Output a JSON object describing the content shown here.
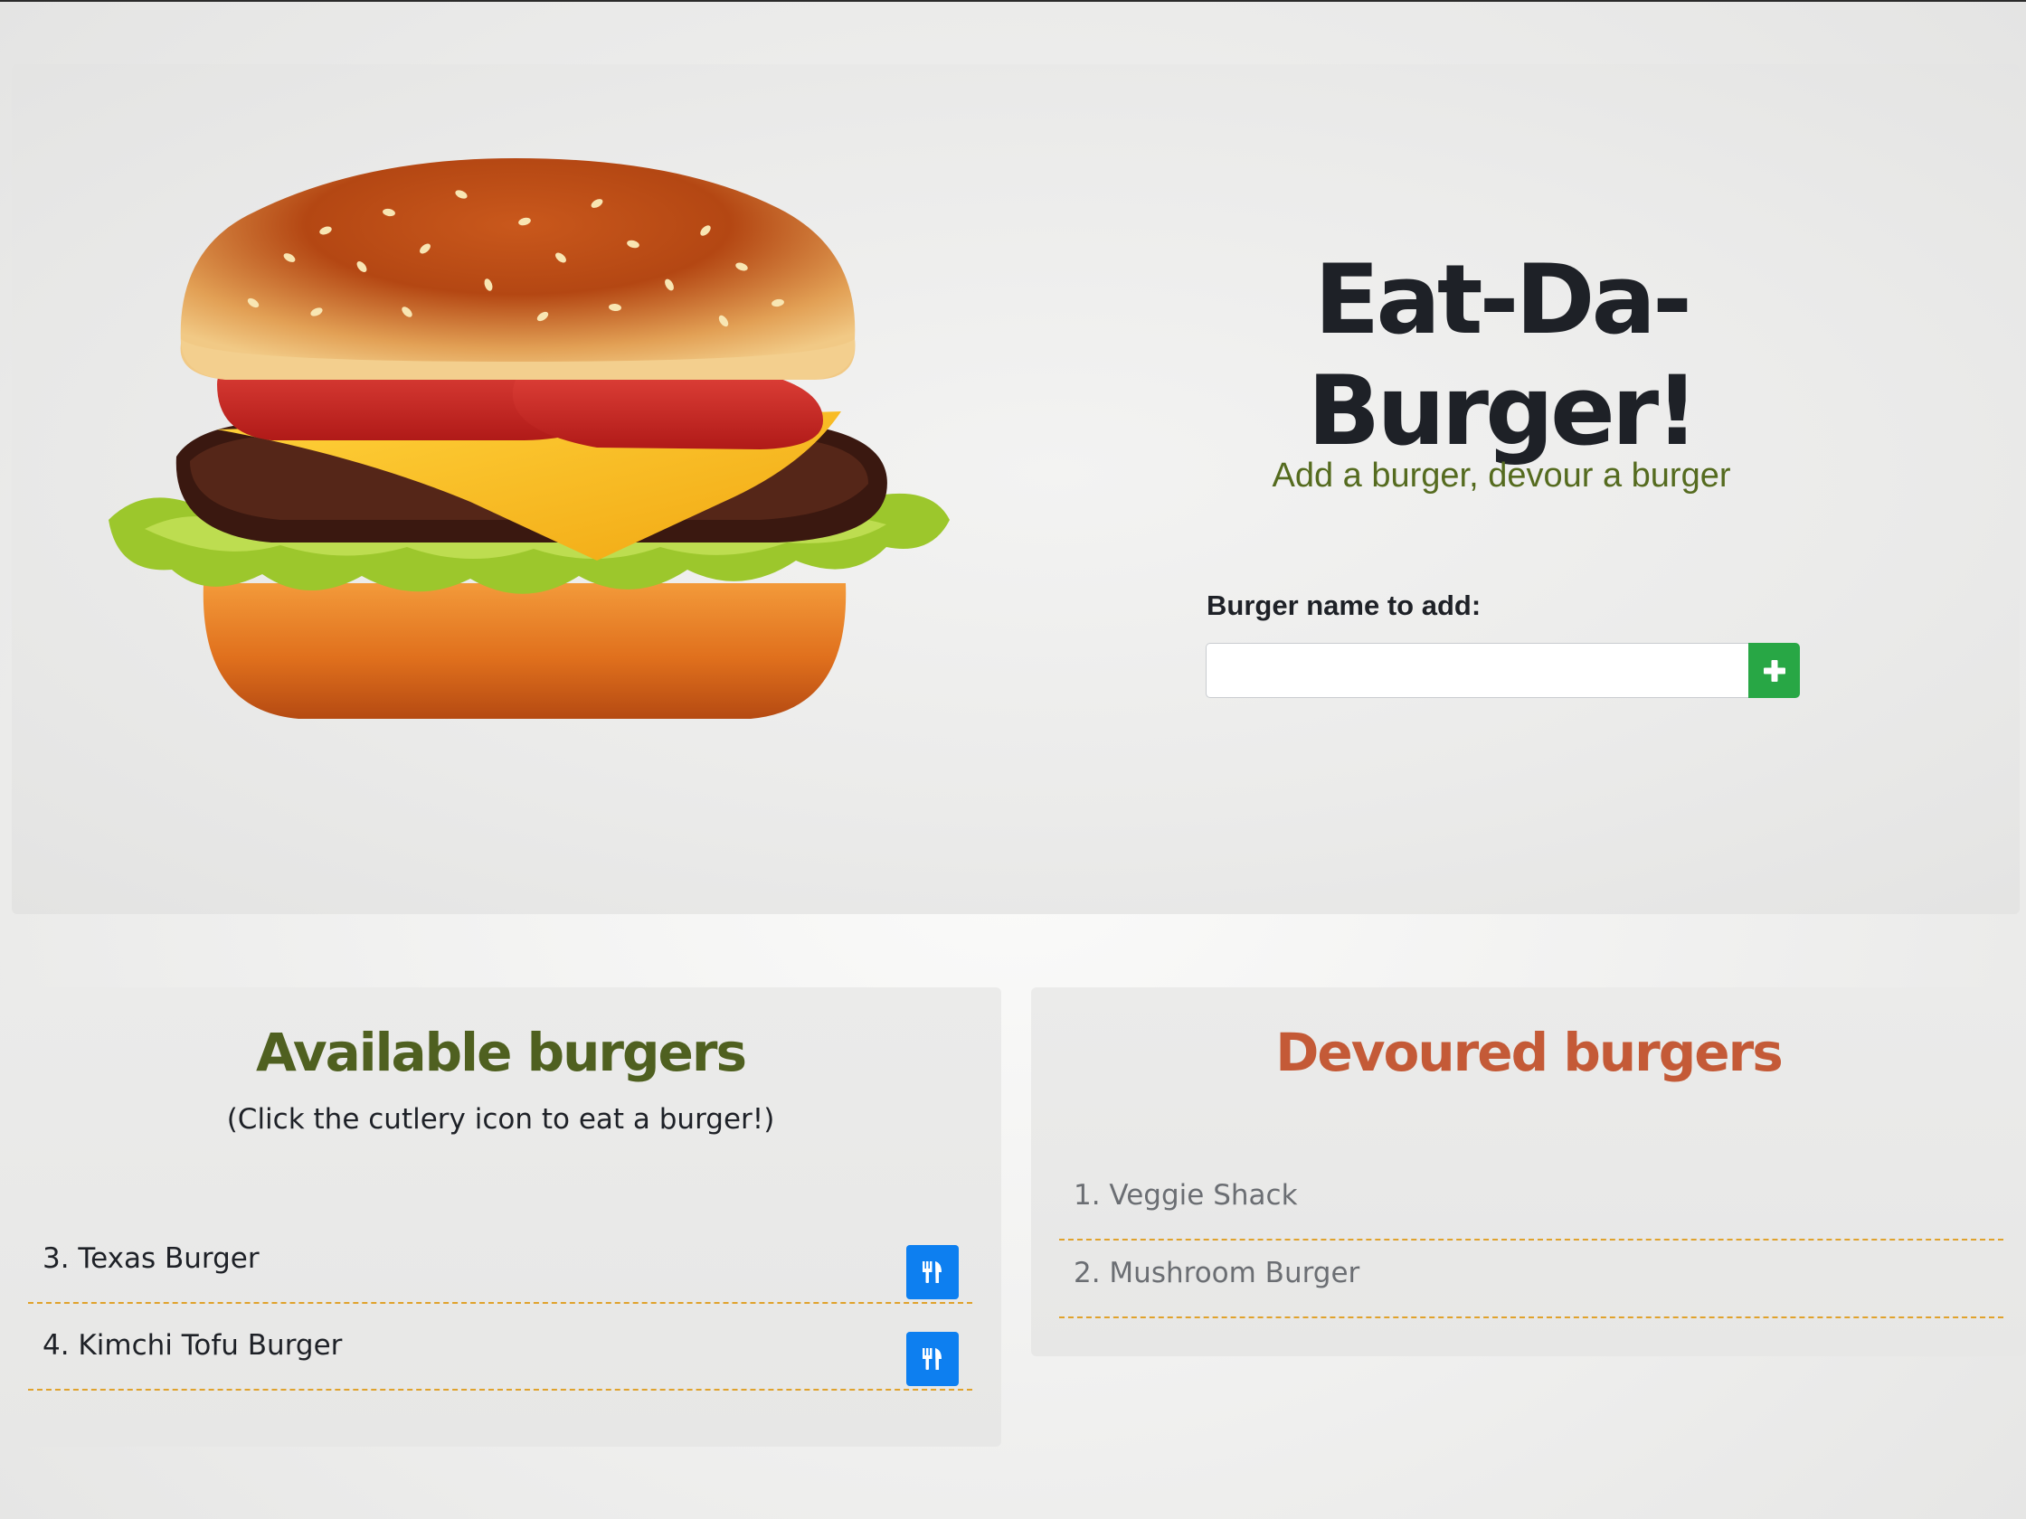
{
  "header": {
    "title": "Eat-Da-Burger!",
    "tagline": "Add a burger, devour a burger"
  },
  "add_form": {
    "label": "Burger name to add:",
    "input_value": "",
    "button_icon": "plus-icon"
  },
  "available": {
    "heading": "Available burgers",
    "hint": "(Click the cutlery icon to eat a burger!)",
    "button_icon": "cutlery-icon",
    "items": [
      {
        "label": "3. Texas Burger"
      },
      {
        "label": "4. Kimchi Tofu Burger"
      }
    ]
  },
  "devoured": {
    "heading": "Devoured burgers",
    "items": [
      {
        "label": "1. Veggie Shack"
      },
      {
        "label": "2. Mushroom Burger"
      }
    ]
  },
  "colors": {
    "add_button": "#28a745",
    "eat_button": "#0d7ff0",
    "available_heading": "#4f6020",
    "devoured_heading": "#c45a37",
    "divider": "#e0a22c",
    "tagline": "#556b1f"
  }
}
